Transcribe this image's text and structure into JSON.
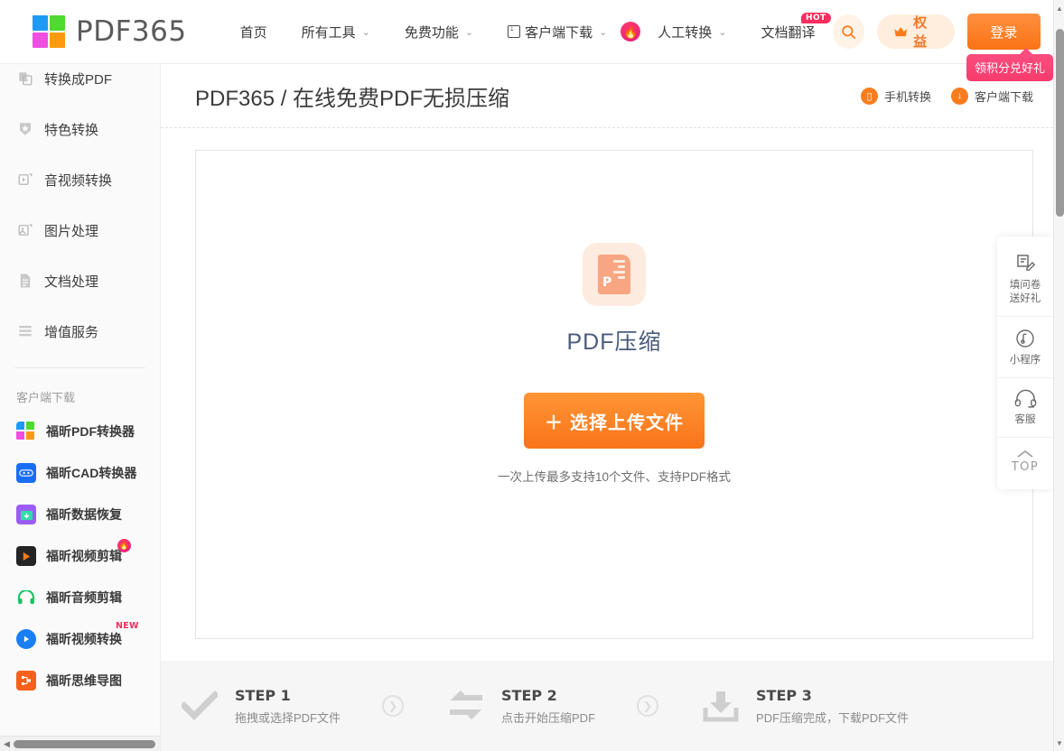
{
  "brand": {
    "name": "PDF365"
  },
  "nav": {
    "items": [
      {
        "label": "首页",
        "caret": false,
        "icon": null,
        "badge": null
      },
      {
        "label": "所有工具",
        "caret": true,
        "icon": null,
        "badge": null
      },
      {
        "label": "免费功能",
        "caret": true,
        "icon": null,
        "badge": null
      },
      {
        "label": "客户端下载",
        "caret": true,
        "icon": "download-box-icon",
        "badge": "fire"
      },
      {
        "label": "人工转换",
        "caret": true,
        "icon": null,
        "badge": null
      },
      {
        "label": "文档翻译",
        "caret": false,
        "icon": null,
        "badge": "HOT"
      }
    ],
    "search_icon": "search-icon",
    "rights_label": "权益",
    "rights_icon": "crown-icon",
    "login_label": "登录",
    "tooltip": "领积分兑好礼"
  },
  "sidebar": {
    "items": [
      {
        "label": "转换成PDF",
        "icon": "convert-to-pdf-icon"
      },
      {
        "label": "特色转换",
        "icon": "star-shield-icon"
      },
      {
        "label": "音视频转换",
        "icon": "media-convert-icon"
      },
      {
        "label": "图片处理",
        "icon": "image-process-icon"
      },
      {
        "label": "文档处理",
        "icon": "document-process-icon"
      },
      {
        "label": "增值服务",
        "icon": "value-added-icon"
      }
    ],
    "download_heading": "客户端下载",
    "apps": [
      {
        "label": "福昕PDF转换器",
        "icon": "foxit-pdf-converter-icon",
        "badge": null
      },
      {
        "label": "福昕CAD转换器",
        "icon": "foxit-cad-converter-icon",
        "badge": null
      },
      {
        "label": "福昕数据恢复",
        "icon": "foxit-data-recovery-icon",
        "badge": null
      },
      {
        "label": "福昕视频剪辑",
        "icon": "foxit-video-editor-icon",
        "badge": "fire"
      },
      {
        "label": "福昕音频剪辑",
        "icon": "foxit-audio-editor-icon",
        "badge": null
      },
      {
        "label": "福昕视频转换",
        "icon": "foxit-video-converter-icon",
        "badge": "NEW"
      },
      {
        "label": "福昕思维导图",
        "icon": "foxit-mindmap-icon",
        "badge": null
      }
    ]
  },
  "page": {
    "title": "PDF365 / 在线免费PDF无损压缩",
    "actions": [
      {
        "label": "手机转换",
        "icon": "phone-icon"
      },
      {
        "label": "客户端下载",
        "icon": "download-icon"
      }
    ]
  },
  "dropzone": {
    "tool_icon": "pdf-compress-file-icon",
    "tool_title": "PDF压缩",
    "upload_button": "选择上传文件",
    "upload_plus": "＋",
    "hint": "一次上传最多支持10个文件、支持PDF格式"
  },
  "steps": [
    {
      "num": "STEP 1",
      "desc": "拖拽或选择PDF文件",
      "icon": "check-icon"
    },
    {
      "num": "STEP 2",
      "desc": "点击开始压缩PDF",
      "icon": "exchange-icon"
    },
    {
      "num": "STEP 3",
      "desc": "PDF压缩完成，下载PDF文件",
      "icon": "download-tray-icon"
    }
  ],
  "floatbar": [
    {
      "label": "填问卷\n送好礼",
      "line1": "填问卷",
      "line2": "送好礼",
      "icon": "survey-icon"
    },
    {
      "label": "小程序",
      "line1": "小程序",
      "line2": "",
      "icon": "miniprogram-icon"
    },
    {
      "label": "客服",
      "line1": "客服",
      "line2": "",
      "icon": "headset-icon"
    },
    {
      "label": "TOP",
      "line1": "TOP",
      "line2": "",
      "icon": "chevron-up-icon"
    }
  ],
  "colors": {
    "accent_orange": "#f97d1e",
    "badge_pink": "#fa2d5e",
    "logo_blue": "#1e9af5",
    "logo_green": "#4ddb2e",
    "logo_magenta": "#ef4fe0",
    "logo_orange": "#ff9a10",
    "file_icon_bg": "#fdebe0",
    "file_icon_fg": "#f7a681",
    "tool_title": "#4a5b7a"
  }
}
